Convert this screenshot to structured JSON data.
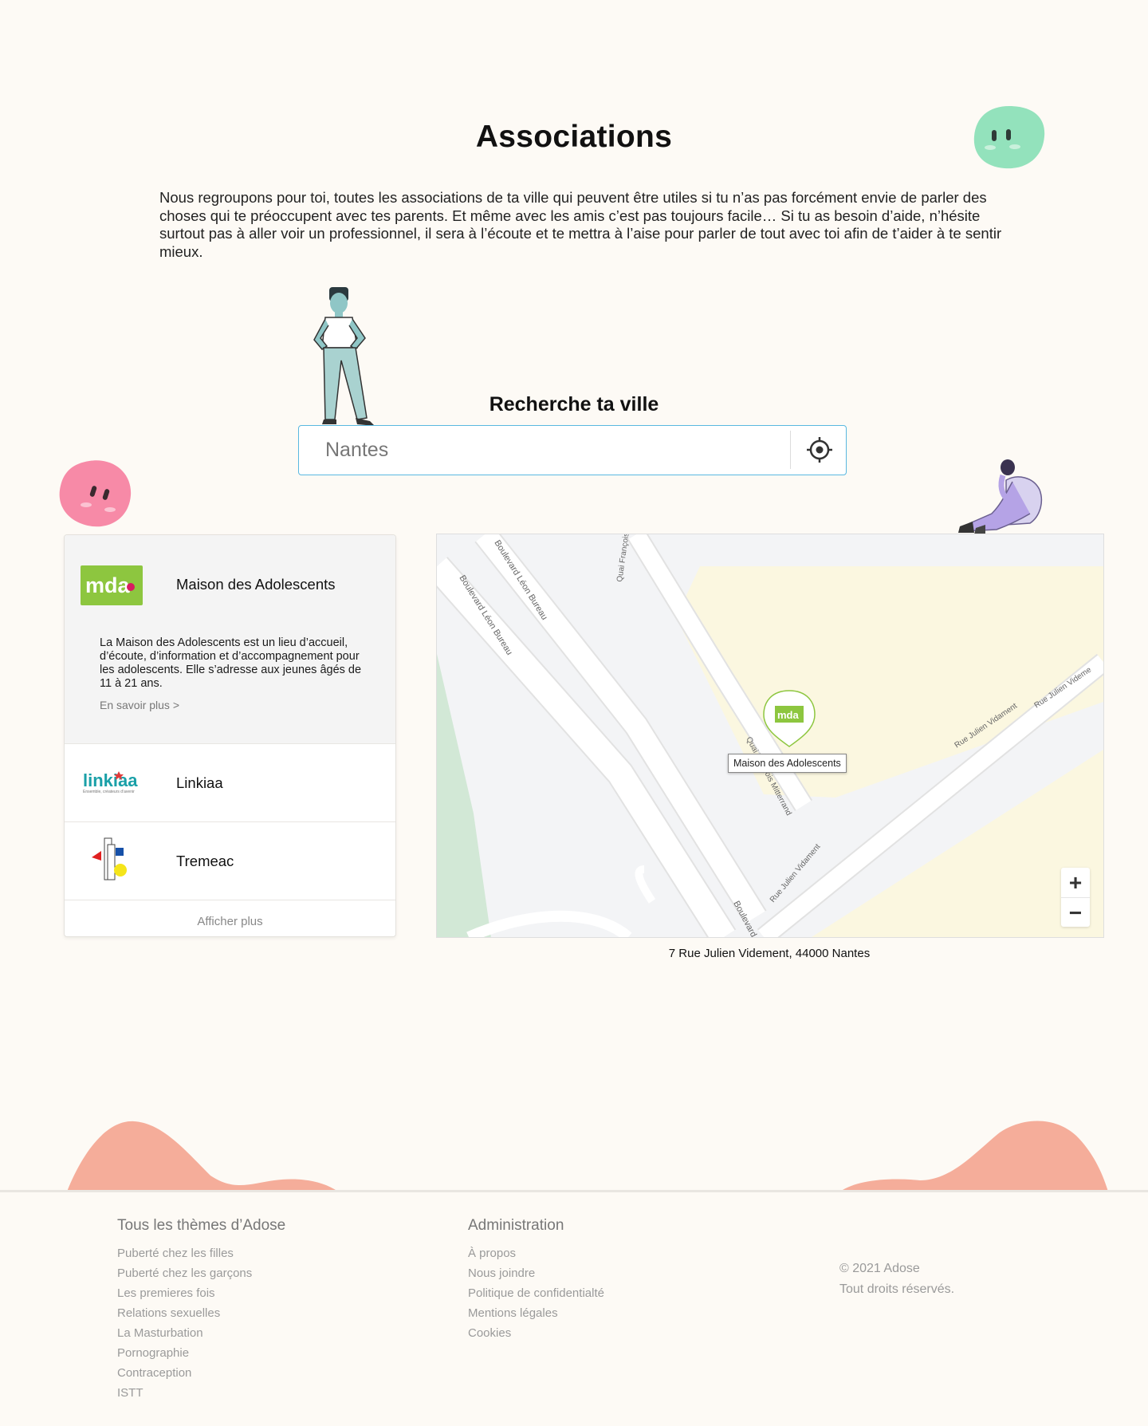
{
  "page": {
    "title": "Associations",
    "intro": "Nous regroupons pour toi, toutes les associations de ta ville qui peuvent être utiles si tu n’as pas forcément envie de parler des choses qui te préoccupent avec tes parents. Et même avec les amis c’est pas toujours facile… Si tu as besoin d’aide, n’hésite surtout pas à aller voir un professionnel, il sera à l’écoute et te mettra à l’aise pour parler de tout avec toi afin de t’aider à te sentir mieux."
  },
  "search": {
    "label": "Recherche ta ville",
    "value": "Nantes",
    "locate_icon": "crosshair-icon"
  },
  "associations": {
    "items": [
      {
        "name": "Maison des Adolescents",
        "logo_text": "mda",
        "description": "La Maison des Adolescents est un lieu d’accueil, d’écoute, d’information et d’accompagnement pour les adolescents. Elle s’adresse aux jeunes âgés de 11 à 21 ans.",
        "more": "En savoir plus >"
      },
      {
        "name": "Linkiaa",
        "logo_text": "linkiaa",
        "logo_tagline": "Ensemble, créateurs d’avenir"
      },
      {
        "name": "Tremeac"
      }
    ],
    "show_more": "Afficher plus"
  },
  "map": {
    "streets": {
      "bd_leon_bureau_1": "Boulevard Léon Bureau",
      "bd_leon_bureau_2": "Boulevard Léon Bureau",
      "quai_francois": "Quai François",
      "quai_mitterrand": "Quai François Mitterrand",
      "rue_vidament_1": "Rue Julien Vidament",
      "rue_vidament_2": "Rue Julien Videme",
      "rue_vidament_3": "Rue Julien Vidament",
      "boulevard": "Boulevard"
    },
    "marker_logo": "mda",
    "tooltip": "Maison des Adolescents",
    "zoom_in": "+",
    "zoom_out": "−"
  },
  "address": "7 Rue Julien Videment, 44000 Nantes",
  "footer": {
    "themes": {
      "heading": "Tous les thèmes d’Adose",
      "links": [
        "Puberté chez les filles",
        "Puberté chez les garçons",
        "Les premieres fois",
        "Relations sexuelles",
        "La Masturbation",
        "Pornographie",
        "Contraception",
        "ISTT"
      ]
    },
    "admin": {
      "heading": "Administration",
      "links": [
        "À propos",
        "Nous joindre",
        "Politique de confidentialté",
        "Mentions légales",
        "Cookies"
      ]
    },
    "copyright": "© 2021 Adose",
    "rights": "Tout droits réservés."
  },
  "colors": {
    "background": "#fdfaf5",
    "accent_blue": "#5ab8e0",
    "mda_green": "#8dc63f",
    "footer_waves": "#f5ad9a",
    "blob_green": "#93e2bc",
    "blob_pink": "#f78aa7"
  }
}
